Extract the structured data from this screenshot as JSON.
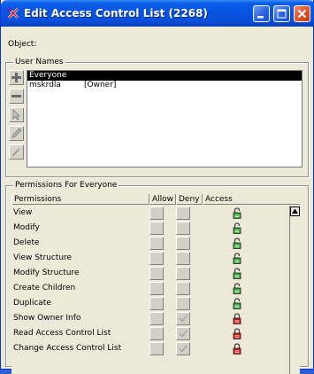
{
  "window": {
    "title": "Edit Access Control List (2268)",
    "titlebar_color": "#0a5ee8",
    "icons": [
      "app-icon",
      "minimize-icon",
      "maximize-icon",
      "close-icon"
    ]
  },
  "object": {
    "label": "Object:"
  },
  "users": {
    "group_title": "User Names",
    "tools": [
      "plus-icon",
      "minus-icon",
      "pointer-icon",
      "pen-icon",
      "wand-icon"
    ],
    "items": [
      {
        "name": "Everyone",
        "role": "",
        "selected": true
      },
      {
        "name": "mskrdla",
        "role": "[Owner]",
        "selected": false
      }
    ]
  },
  "permissions": {
    "group_title": "Permissions For Everyone",
    "columns": [
      "Permissions",
      "Allow",
      "Deny",
      "Access"
    ],
    "rows": [
      {
        "name": "View",
        "deny_checked": false,
        "access": "unlocked-green"
      },
      {
        "name": "Modify",
        "deny_checked": false,
        "access": "unlocked-green"
      },
      {
        "name": "Delete",
        "deny_checked": false,
        "access": "unlocked-green"
      },
      {
        "name": "View Structure",
        "deny_checked": false,
        "access": "unlocked-green"
      },
      {
        "name": "Modify Structure",
        "deny_checked": false,
        "access": "unlocked-green"
      },
      {
        "name": "Create Children",
        "deny_checked": false,
        "access": "unlocked-green"
      },
      {
        "name": "Duplicate",
        "deny_checked": false,
        "access": "unlocked-green"
      },
      {
        "name": "Show Owner Info",
        "deny_checked": true,
        "access": "locked-red"
      },
      {
        "name": "Read Access Control List",
        "deny_checked": true,
        "access": "locked-red"
      },
      {
        "name": "Change Access Control List",
        "deny_checked": true,
        "access": "locked-red"
      }
    ],
    "colors": {
      "unlocked": "#2ea82e",
      "locked": "#d41414"
    }
  }
}
